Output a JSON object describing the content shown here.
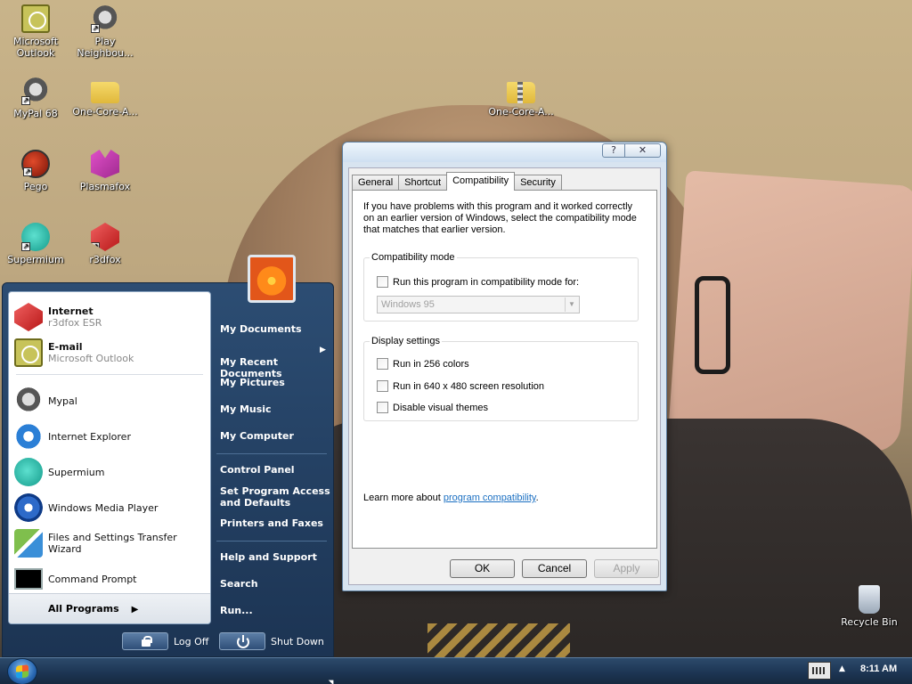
{
  "desktop": {
    "icons": [
      {
        "label": "Microsoft Outlook",
        "icon": "outlook-icon"
      },
      {
        "label": "Play Neighbou...",
        "icon": "raccoon-icon"
      },
      {
        "label": "MyPal 68",
        "icon": "raccoon-icon"
      },
      {
        "label": "One-Core-A...",
        "icon": "folder-icon"
      },
      {
        "label": "One-Core-A...",
        "icon": "zip-folder-icon"
      },
      {
        "label": "Pego",
        "icon": "pego-icon"
      },
      {
        "label": "Plasmafox",
        "icon": "plasmafox-icon"
      },
      {
        "label": "Supermium",
        "icon": "supermium-icon"
      },
      {
        "label": "r3dfox",
        "icon": "r3dfox-icon"
      },
      {
        "label": "Recycle Bin",
        "icon": "recycle-bin-icon"
      }
    ]
  },
  "dialog": {
    "title_buttons": {
      "help": "?",
      "close": "✕"
    },
    "tabs": [
      {
        "label": "General"
      },
      {
        "label": "Shortcut"
      },
      {
        "label": "Compatibility"
      },
      {
        "label": "Security"
      }
    ],
    "active_tab": "Compatibility",
    "intro": "If you have problems with this program and it worked correctly on an earlier version of Windows, select the compatibility mode that matches that earlier version.",
    "compat_group": {
      "title": "Compatibility mode",
      "checkbox_label": "Run this program in compatibility mode for:",
      "checked": false,
      "select_value": "Windows 95"
    },
    "display_group": {
      "title": "Display settings",
      "options": [
        {
          "label": "Run in 256 colors",
          "checked": false
        },
        {
          "label": "Run in 640 x 480 screen resolution",
          "checked": false
        },
        {
          "label": "Disable visual themes",
          "checked": false
        }
      ]
    },
    "learn_more_prefix": "Learn more about ",
    "learn_more_link": "program compatibility",
    "learn_more_suffix": ".",
    "buttons": {
      "ok": "OK",
      "cancel": "Cancel",
      "apply": "Apply"
    }
  },
  "start_menu": {
    "pinned": [
      {
        "title": "Internet",
        "subtitle": "r3dfox ESR",
        "icon": "r3dfox-icon"
      },
      {
        "title": "E-mail",
        "subtitle": "Microsoft Outlook",
        "icon": "outlook-icon"
      }
    ],
    "recent": [
      {
        "label": "Mypal",
        "icon": "raccoon-icon"
      },
      {
        "label": "Internet Explorer",
        "icon": "internet-explorer-icon"
      },
      {
        "label": "Supermium",
        "icon": "supermium-icon"
      },
      {
        "label": "Windows Media Player",
        "icon": "media-player-icon"
      },
      {
        "label": "Files and Settings Transfer Wizard",
        "icon": "transfer-wizard-icon"
      },
      {
        "label": "Command Prompt",
        "icon": "command-prompt-icon"
      }
    ],
    "all_programs": "All Programs",
    "right": [
      {
        "label": "My Documents"
      },
      {
        "label": "My Recent\nDocuments"
      },
      {
        "label": "My Pictures"
      },
      {
        "label": "My Music"
      },
      {
        "label": "My Computer"
      },
      {
        "label": "Control Panel"
      },
      {
        "label": "Set Program Access\nand Defaults"
      },
      {
        "label": "Printers and Faxes"
      },
      {
        "label": "Help and Support"
      },
      {
        "label": "Search"
      },
      {
        "label": "Run..."
      }
    ],
    "log_off": "Log Off",
    "shut_down": "Shut Down"
  },
  "taskbar": {
    "clock": "8:11 AM",
    "tray_arrow": "▲"
  },
  "colors": {
    "start_menu_bg": "#1c3453",
    "link": "#1a6fc2",
    "dialog_frame": "#d8e4f0"
  }
}
